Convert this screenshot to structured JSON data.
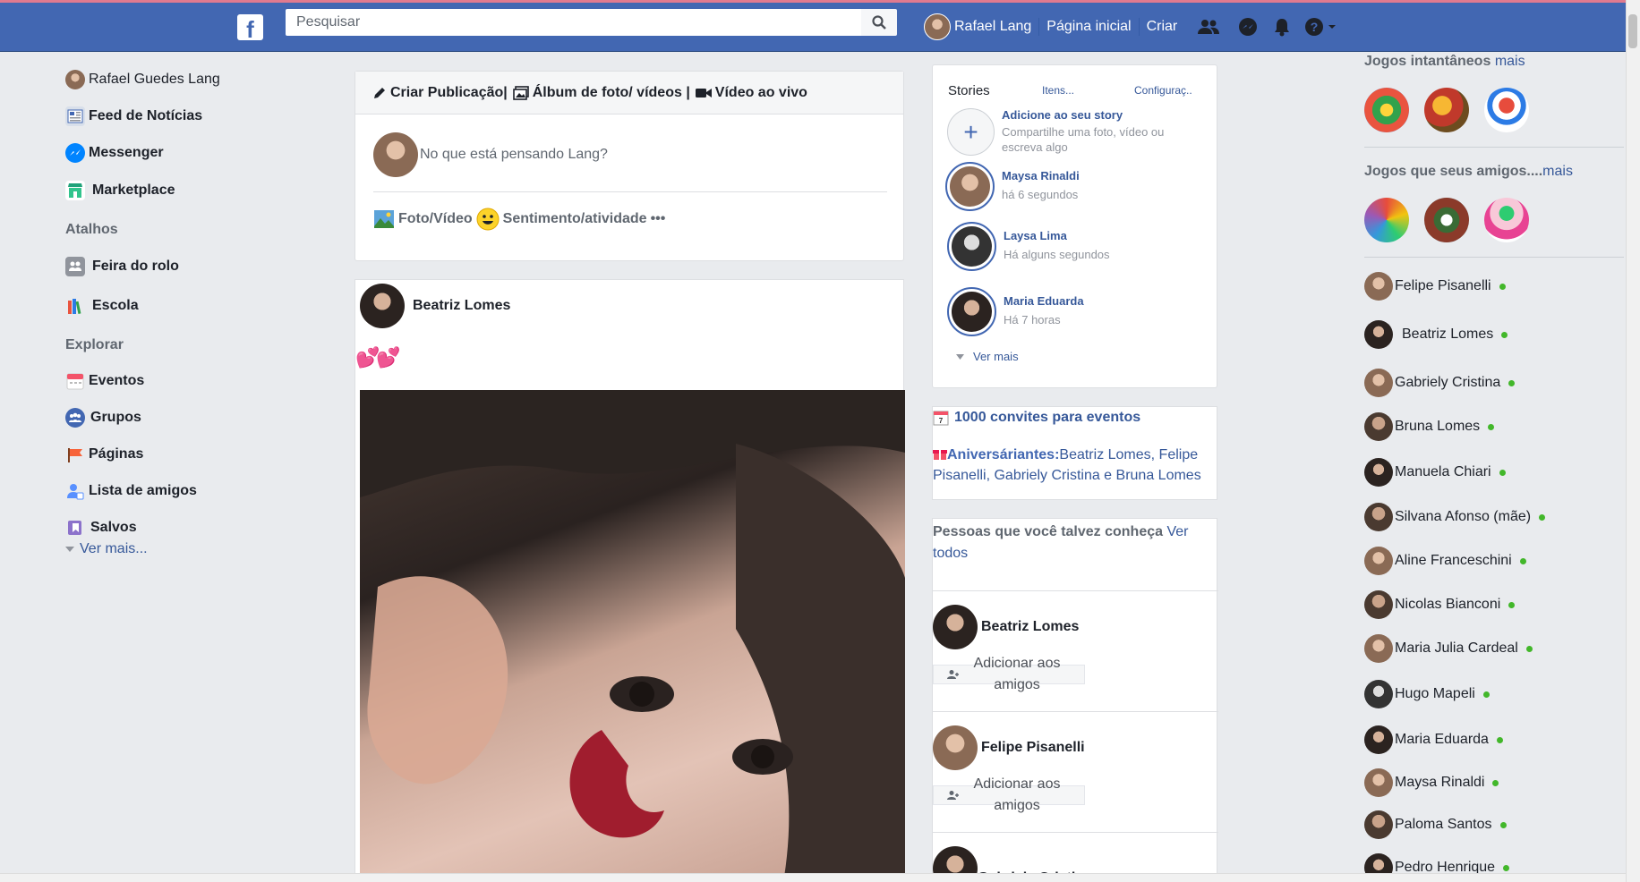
{
  "header": {
    "logo": "f",
    "search_placeholder": "Pesquisar",
    "profile_name": "Rafael Lang",
    "home_link": "Página inicial",
    "create_link": "Criar"
  },
  "left_nav": {
    "profile": "Rafael Guedes Lang",
    "feed": "Feed de Notícias",
    "messenger": "Messenger",
    "marketplace": "Marketplace",
    "shortcuts_title": "Atalhos",
    "shortcut_1": "Feira do rolo",
    "shortcut_2": "Escola",
    "explore_title": "Explorar",
    "events": "Eventos",
    "groups": "Grupos",
    "pages": "Páginas",
    "friend_lists": "Lista de amigos",
    "saved": "Salvos",
    "see_more": "Ver mais..."
  },
  "composer": {
    "create_post": "Criar Publicação|",
    "album": "Álbum de foto/ vídeos |",
    "live": "Vídeo ao vivo",
    "placeholder": "No que está pensando Lang?",
    "photo_video": "Foto/Vídeo",
    "feeling": "Sentimento/atividade",
    "more": "•••"
  },
  "post": {
    "author": "Beatriz Lomes",
    "text": "💕💕"
  },
  "stories": {
    "title": "Stories",
    "items_link": "Itens...",
    "settings_link": "Configuraç..",
    "add_title": "Adicione ao seu story",
    "add_desc": "Compartilhe uma foto, vídeo ou escreva algo",
    "entries": [
      {
        "name": "Maysa Rinaldi",
        "time": "há 6 segundos"
      },
      {
        "name": "Laysa Lima",
        "time": "Há alguns segundos"
      },
      {
        "name": "Maria Eduarda",
        "time": "Há 7 horas"
      }
    ],
    "see_more": "Ver mais"
  },
  "events": {
    "invites": "1000 convites para eventos",
    "birthday_label": "Aniversáriantes:",
    "birthday_names": "Beatriz Lomes, Felipe Pisanelli, Gabriely Cristina e Bruna Lomes"
  },
  "pymk": {
    "title": "Pessoas que você talvez conheça",
    "see_all": "Ver todos",
    "add_label": "Adicionar aos amigos",
    "people": [
      "Beatriz Lomes",
      "Felipe Pisanelli",
      "Gabriely Cristina"
    ]
  },
  "games": {
    "instant_title": "Jogos intantâneos",
    "instant_more": "mais",
    "friends_title": "Jogos que seus amigos....",
    "friends_more": "mais"
  },
  "contacts": [
    "Felipe Pisanelli",
    "Beatriz Lomes",
    "Gabriely Cristina",
    "Bruna Lomes",
    "Manuela Chiari",
    "Silvana Afonso (mãe)",
    "Aline Franceschini",
    "Nicolas Bianconi",
    "Maria Julia Cardeal",
    "Hugo Mapeli",
    "Maria Eduarda",
    "Maysa Rinaldi",
    "Paloma Santos",
    "Pedro Henrique"
  ],
  "colors": {
    "brand": "#4267b2",
    "link": "#365899",
    "online": "#42b72a"
  }
}
